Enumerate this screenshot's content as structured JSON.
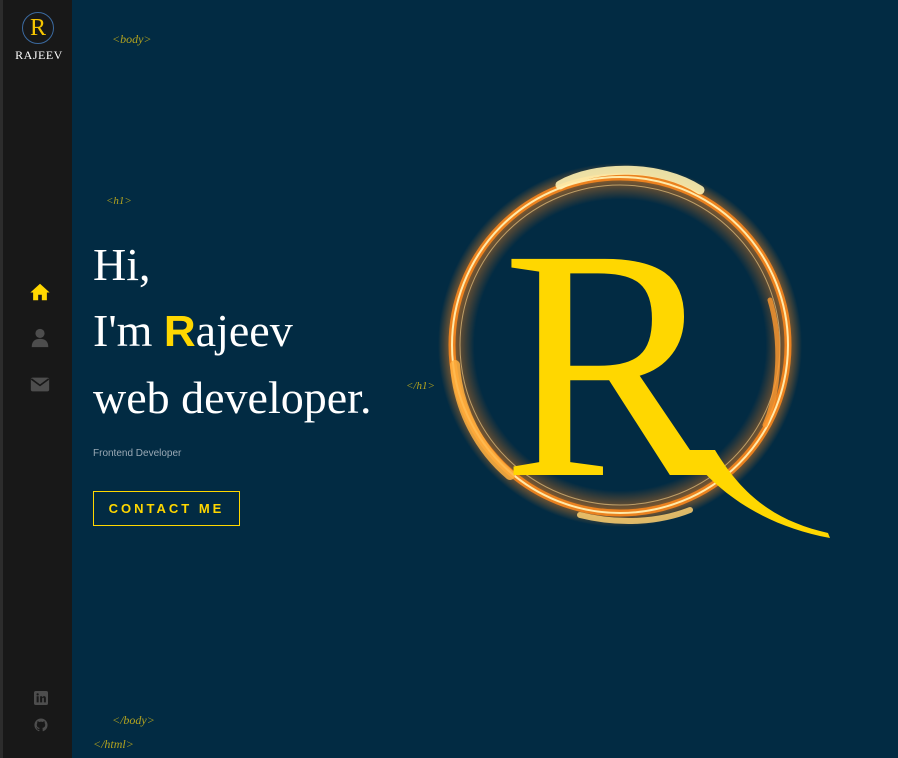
{
  "sidebar": {
    "logo_letter": "R",
    "logo_name": "RAJEEV",
    "nav": [
      {
        "icon": "home-icon",
        "active": true
      },
      {
        "icon": "user-icon",
        "active": false
      },
      {
        "icon": "envelope-icon",
        "active": false
      }
    ],
    "social": [
      {
        "icon": "linkedin-icon"
      },
      {
        "icon": "github-icon"
      }
    ]
  },
  "code_tags": {
    "body_open": "<body>",
    "h1_open": "<h1>",
    "h1_close": "</h1>",
    "body_close": "</body>",
    "html_close": "</html>"
  },
  "hero": {
    "line1": "Hi,",
    "line2_prefix": "I'm ",
    "line2_accent": "R",
    "line2_rest": "ajeev",
    "line3": "web developer.",
    "subtitle": "Frontend Developer",
    "cta_label": "CONTACT ME"
  },
  "emblem": {
    "letter": "R"
  },
  "colors": {
    "background": "#022b43",
    "sidebar": "#181818",
    "accent": "#ffd700",
    "tag": "#b3a31f",
    "fire": "#ff8a1c"
  }
}
